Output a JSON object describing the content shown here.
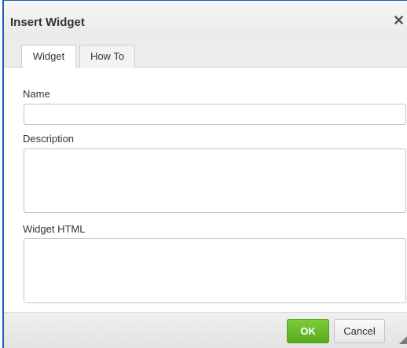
{
  "dialog": {
    "title": "Insert Widget",
    "close_glyph": "✕",
    "close_icon": "close-icon"
  },
  "tabs": [
    {
      "label": "Widget",
      "selected": true
    },
    {
      "label": "How To",
      "selected": false
    }
  ],
  "fields": {
    "name": {
      "label": "Name",
      "value": ""
    },
    "description": {
      "label": "Description",
      "value": ""
    },
    "widget_html": {
      "label": "Widget HTML",
      "value": ""
    }
  },
  "buttons": {
    "ok": "OK",
    "cancel": "Cancel"
  },
  "colors": {
    "accent_border": "#1a5fb4",
    "ok_button": "#6bbd2c"
  }
}
